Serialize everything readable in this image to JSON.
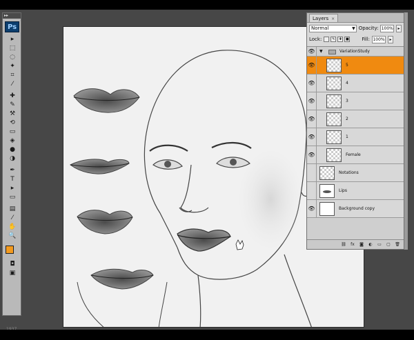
{
  "app": {
    "logo": "Ps",
    "status_bottom": "1937"
  },
  "toolbox": {
    "icons": [
      "move-tool-icon",
      "marquee-tool-icon",
      "lasso-tool-icon",
      "magic-wand-icon",
      "crop-tool-icon",
      "eyedropper-icon",
      "healing-brush-icon",
      "brush-tool-icon",
      "clone-stamp-icon",
      "history-brush-icon",
      "eraser-icon",
      "paint-bucket-icon",
      "blur-tool-icon",
      "dodge-tool-icon",
      "pen-tool-icon",
      "type-tool-icon",
      "path-select-icon",
      "shape-tool-icon",
      "notes-tool-icon",
      "eyedropper-2-icon",
      "hand-tool-icon",
      "zoom-tool-icon"
    ],
    "glyphs": [
      "▸",
      "⬚",
      "◌",
      "✦",
      "⌗",
      "⁄",
      "✚",
      "✎",
      "⚒",
      "⟲",
      "▭",
      "◈",
      "●",
      "◑",
      "✒",
      "T",
      "▸",
      "▭",
      "▤",
      "⁄",
      "✋",
      "🔍"
    ],
    "foreground_color": "#f39a1e",
    "background_color": "#ffffff"
  },
  "layers_panel": {
    "tab_label": "Layers",
    "close_glyph": "×",
    "blend_mode": "Normal",
    "opacity_label": "Opacity:",
    "opacity_value": "100%",
    "lock_label": "Lock:",
    "fill_label": "Fill:",
    "fill_value": "100%",
    "layers": [
      {
        "name": "VariationStudy",
        "type": "group",
        "visible": true
      },
      {
        "name": "5",
        "type": "layer",
        "visible": true,
        "selected": true,
        "indent": true
      },
      {
        "name": "4",
        "type": "layer",
        "visible": true,
        "indent": true
      },
      {
        "name": "3",
        "type": "layer",
        "visible": true,
        "indent": true
      },
      {
        "name": "2",
        "type": "layer",
        "visible": true,
        "indent": true
      },
      {
        "name": "1",
        "type": "layer",
        "visible": true,
        "indent": true
      },
      {
        "name": "Female",
        "type": "layer",
        "visible": true,
        "indent": true
      },
      {
        "name": "Notations",
        "type": "layer",
        "visible": false
      },
      {
        "name": "Lips",
        "type": "layer",
        "visible": false,
        "thumb": "lips"
      },
      {
        "name": "Background copy",
        "type": "layer",
        "visible": true,
        "thumb": "white"
      }
    ],
    "footer_icons": [
      "link-layers-icon",
      "fx-icon",
      "layer-mask-icon",
      "adjustment-layer-icon",
      "new-group-icon",
      "new-layer-icon",
      "trash-icon"
    ],
    "footer_glyphs": [
      "⛓",
      "fx",
      "◙",
      "◐",
      "▭",
      "▢",
      "🗑"
    ]
  },
  "colors": {
    "selected_layer": "#f08a10",
    "canvas": "#f1f1f1",
    "workspace": "#474747"
  }
}
